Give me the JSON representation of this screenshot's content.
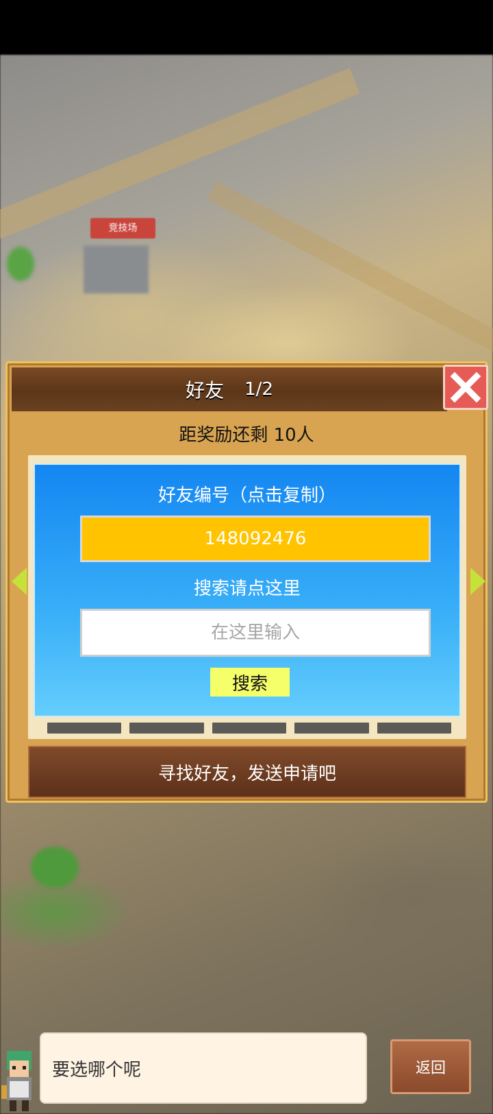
{
  "map": {
    "arena_sign": "竞技场"
  },
  "dialog": {
    "title": "好友",
    "page": "1/2",
    "reward_text": "距奖励还剩 10人",
    "id_label": "好友编号（点击复制）",
    "friend_id": "148092476",
    "search_label": "搜索请点这里",
    "search_placeholder": "在这里输入",
    "search_button": "搜索",
    "find_banner": "寻找好友，发送申请吧",
    "close_icon": "close-x-icon",
    "prev_icon": "arrow-left-icon",
    "next_icon": "arrow-right-icon"
  },
  "footer": {
    "speech": "要选哪个呢",
    "back_button": "返回"
  },
  "colors": {
    "dialog_bg": "#d8a451",
    "header_bg": "#5c3618",
    "panel_blue": "#1486f2",
    "id_box": "#ffc300",
    "search_btn": "#f5ff6a",
    "close_red": "#e65b55",
    "arrow_green": "#c6e23a"
  }
}
